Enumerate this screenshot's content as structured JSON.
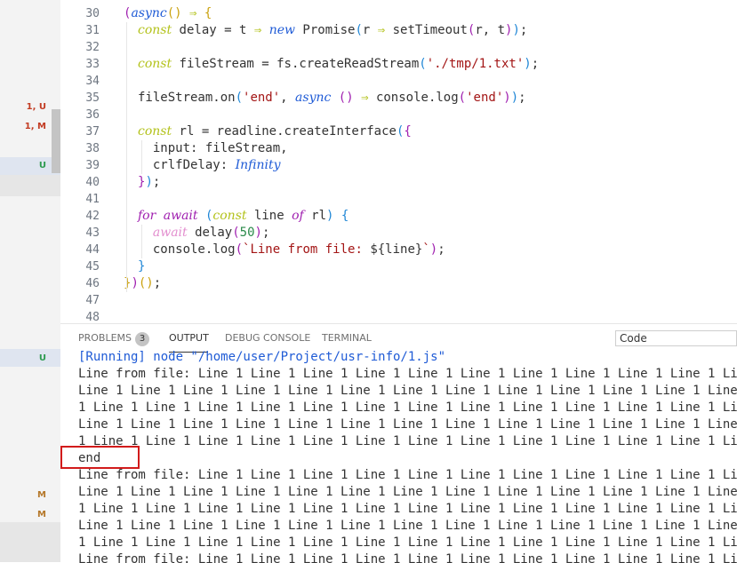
{
  "sidebar": {
    "marks": [
      {
        "text": "1, U",
        "color": "#c23b22"
      },
      {
        "text": "1, M",
        "color": "#c23b22"
      },
      {
        "text": "U",
        "color": "#2d9b4f"
      },
      {
        "text": "U",
        "color": "#2d9b4f"
      },
      {
        "text": "M",
        "color": "#b5782a"
      },
      {
        "text": "M",
        "color": "#b5782a"
      }
    ],
    "breakpoint_glyph": "()"
  },
  "editor": {
    "lines": [
      {
        "n": "30",
        "code": [
          [
            "p1",
            "("
          ],
          [
            "kw3",
            "async"
          ],
          [
            "p2",
            "()"
          ],
          [
            "",
            " "
          ],
          [
            "op",
            "⇒"
          ],
          [
            "",
            " "
          ],
          [
            "p2",
            "{"
          ]
        ]
      },
      {
        "n": "31",
        "code": [
          [
            "kw",
            "const"
          ],
          [
            "",
            " delay = t "
          ],
          [
            "op",
            "⇒"
          ],
          [
            "",
            " "
          ],
          [
            "kw3",
            "new"
          ],
          [
            "",
            " Promise"
          ],
          [
            "p3",
            "("
          ],
          [
            "",
            "r "
          ],
          [
            "op",
            "⇒"
          ],
          [
            "",
            " setTimeout"
          ],
          [
            "p1",
            "("
          ],
          [
            "",
            "r, t"
          ],
          [
            "p1",
            ")"
          ],
          [
            "p3",
            ")"
          ],
          [
            "",
            ";"
          ]
        ]
      },
      {
        "n": "32",
        "code": []
      },
      {
        "n": "33",
        "code": [
          [
            "kw",
            "const"
          ],
          [
            "",
            " fileStream = fs.createReadStream"
          ],
          [
            "p3",
            "("
          ],
          [
            "str",
            "'./tmp/1.txt'"
          ],
          [
            "p3",
            ")"
          ],
          [
            "",
            ";"
          ]
        ]
      },
      {
        "n": "34",
        "code": []
      },
      {
        "n": "35",
        "code": [
          [
            "",
            "fileStream.on"
          ],
          [
            "p3",
            "("
          ],
          [
            "str",
            "'end'"
          ],
          [
            "",
            ", "
          ],
          [
            "kw3",
            "async"
          ],
          [
            "",
            " "
          ],
          [
            "p1",
            "()"
          ],
          [
            "",
            " "
          ],
          [
            "op",
            "⇒"
          ],
          [
            "",
            " console.log"
          ],
          [
            "p1",
            "("
          ],
          [
            "str",
            "'end'"
          ],
          [
            "p1",
            ")"
          ],
          [
            "p3",
            ")"
          ],
          [
            "",
            ";"
          ]
        ]
      },
      {
        "n": "36",
        "code": []
      },
      {
        "n": "37",
        "code": [
          [
            "kw",
            "const"
          ],
          [
            "",
            " rl = readline.createInterface"
          ],
          [
            "p3",
            "("
          ],
          [
            "p1",
            "{"
          ]
        ]
      },
      {
        "n": "38",
        "code": [
          [
            "",
            "  input: fileStream,"
          ]
        ]
      },
      {
        "n": "39",
        "code": [
          [
            "",
            "  crlfDelay: "
          ],
          [
            "kw3",
            "Infinity"
          ]
        ]
      },
      {
        "n": "40",
        "code": [
          [
            "p1",
            "}"
          ],
          [
            "p3",
            ")"
          ],
          [
            "",
            ";"
          ]
        ]
      },
      {
        "n": "41",
        "code": []
      },
      {
        "n": "42",
        "code": [
          [
            "kw2",
            "for"
          ],
          [
            "",
            " "
          ],
          [
            "kw2",
            "await"
          ],
          [
            "",
            " "
          ],
          [
            "p3",
            "("
          ],
          [
            "kw",
            "const"
          ],
          [
            "",
            " line "
          ],
          [
            "kw2",
            "of"
          ],
          [
            "",
            " rl"
          ],
          [
            "p3",
            ")"
          ],
          [
            "",
            " "
          ],
          [
            "p3",
            "{"
          ]
        ]
      },
      {
        "n": "43",
        "code": [
          [
            "",
            "  "
          ],
          [
            "kwp",
            "await"
          ],
          [
            "",
            " delay"
          ],
          [
            "p1",
            "("
          ],
          [
            "num",
            "50"
          ],
          [
            "p1",
            ")"
          ],
          [
            "",
            ";"
          ]
        ]
      },
      {
        "n": "44",
        "code": [
          [
            "",
            "  console.log"
          ],
          [
            "p1",
            "("
          ],
          [
            "tpl",
            "`Line from file: "
          ],
          [
            "",
            "${line}"
          ],
          [
            "tpl",
            "`"
          ],
          [
            "p1",
            ")"
          ],
          [
            "",
            ";"
          ]
        ]
      },
      {
        "n": "45",
        "code": [
          [
            "p3",
            "}"
          ]
        ]
      },
      {
        "n": "46",
        "code": [
          [
            "p2",
            "}"
          ],
          [
            "p1",
            ")"
          ],
          [
            "p2",
            "()"
          ],
          [
            "",
            ";"
          ]
        ]
      },
      {
        "n": "47",
        "code": []
      },
      {
        "n": "48",
        "code": []
      }
    ]
  },
  "panel": {
    "tabs": [
      {
        "label": "PROBLEMS",
        "badge": "3"
      },
      {
        "label": "OUTPUT",
        "badge": ""
      },
      {
        "label": "DEBUG CONSOLE",
        "badge": ""
      },
      {
        "label": "TERMINAL",
        "badge": ""
      }
    ],
    "active_tab": "OUTPUT",
    "output_channel": "Code",
    "output_lines": [
      "[Running] node \"/home/user/Project/usr-info/1.js\"",
      "Line from file: Line 1 Line 1 Line 1 Line 1 Line 1 Line 1 Line 1 Line 1 Line 1 Line 1 Line 1 Line 1",
      "Line 1 Line 1 Line 1 Line 1 Line 1 Line 1 Line 1 Line 1 Line 1 Line 1 Line 1 Line 1 Line 1 Line 1 Line",
      "1 Line 1 Line 1 Line 1 Line 1 Line 1 Line 1 Line 1 Line 1 Line 1 Line 1 Line 1 Line 1 Line 1 Line 1 Line",
      "Line 1 Line 1 Line 1 Line 1 Line 1 Line 1 Line 1 Line 1 Line 1 Line 1 Line 1 Line 1 Line 1 Line 1 Line",
      "1 Line 1 Line 1 Line 1 Line 1 Line 1 Line 1 Line 1 Line 1 Line 1 Line 1 Line 1 Line 1 Line 1 Line 1",
      "end",
      "Line from file: Line 1 Line 1 Line 1 Line 1 Line 1 Line 1 Line 1 Line 1 Line 1 Line 1 Line 1 Line 1",
      "Line 1 Line 1 Line 1 Line 1 Line 1 Line 1 Line 1 Line 1 Line 1 Line 1 Line 1 Line 1 Line 1 Line 1 Line",
      "1 Line 1 Line 1 Line 1 Line 1 Line 1 Line 1 Line 1 Line 1 Line 1 Line 1 Line 1 Line 1 Line 1 Line 1 Line",
      "Line 1 Line 1 Line 1 Line 1 Line 1 Line 1 Line 1 Line 1 Line 1 Line 1 Line 1 Line 1 Line 1 Line 1 Line",
      "1 Line 1 Line 1 Line 1 Line 1 Line 1 Line 1 Line 1 Line 1 Line 1 Line 1 Line 1 Line 1 Line 1 Line 1",
      "Line from file: Line 1 Line 1 Line 1 Line 1 Line 1 Line 1 Line 1 Line 1 Line 1 Line 1 Line 1 Line 1"
    ],
    "highlight_color": "#d21b1b"
  }
}
